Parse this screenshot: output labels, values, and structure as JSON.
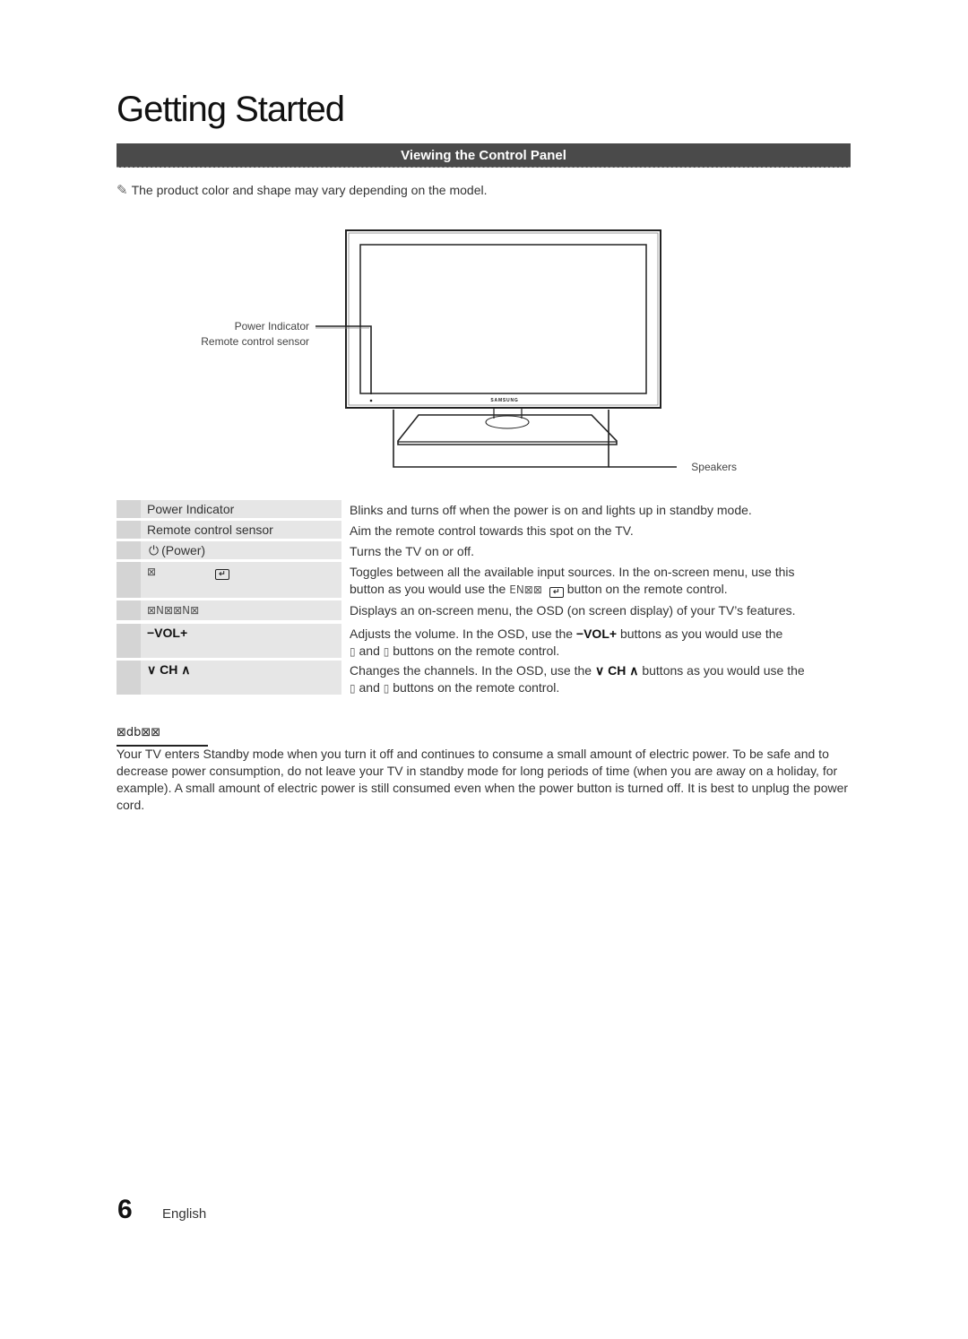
{
  "page": {
    "title": "Getting Started",
    "section_title": "Viewing the Control Panel",
    "note": {
      "icon": "pencil-icon",
      "text": "The product color and shape may vary depending on the model."
    }
  },
  "diagram": {
    "labels": {
      "power_indicator": "Power Indicator",
      "remote_sensor": "Remote control sensor",
      "speakers": "Speakers",
      "brand": "SAMSUNG"
    }
  },
  "controls": [
    {
      "name": "Power Indicator",
      "desc": "Blinks and turns off when the power is on and lights up in standby mode."
    },
    {
      "name": "Remote control sensor",
      "desc": "Aim the remote control towards this spot on the TV."
    },
    {
      "name": "(Power)",
      "icon": "power-icon",
      "desc": "Turns the TV on or off."
    },
    {
      "name_glyph": "⊠",
      "icon": "source-enter-icon",
      "desc_line1": "Toggles between all the available input sources. In the on-screen menu, use this",
      "desc_line2_pre": "button as you would use the",
      "desc_line2_glyph": "EN⊠⊠",
      "desc_line2_post": "button on the remote control."
    },
    {
      "name_glyph": "⊠N⊠⊠N⊠",
      "desc": "Displays an on-screen menu, the OSD (on screen display) of your TV’s features."
    },
    {
      "name": "−VOL+",
      "desc_line1_pre": "Adjusts the volume. In the OSD, use the",
      "desc_line1_btn": "−VOL+",
      "desc_line1_post": "buttons as you would use the",
      "desc_line2_glyph1": "▯",
      "desc_line2_and": "and",
      "desc_line2_glyph2": "▯",
      "desc_line2_post": "buttons on the remote control."
    },
    {
      "name": "∨ CH ∧",
      "desc_line1_pre": "Changes the channels. In the OSD, use the",
      "desc_line1_btn": "∨ CH ∧",
      "desc_line1_post": "buttons as you would use the",
      "desc_line2_glyph1": "▯",
      "desc_line2_and": "and",
      "desc_line2_glyph2": "▯",
      "desc_line2_post": "buttons on the remote control."
    }
  ],
  "standby": {
    "heading_glyph": "⊠db⊠⊠",
    "text": "Your TV enters Standby mode when you turn it off and continues to consume a small amount of electric power. To be safe and to decrease power consumption, do not leave your TV in standby mode for long periods of time (when you are away on a holiday, for example). A small amount of electric power is still consumed even when the power button is turned off. It is best to unplug the power cord."
  },
  "footer": {
    "page_number": "6",
    "language": "English"
  }
}
